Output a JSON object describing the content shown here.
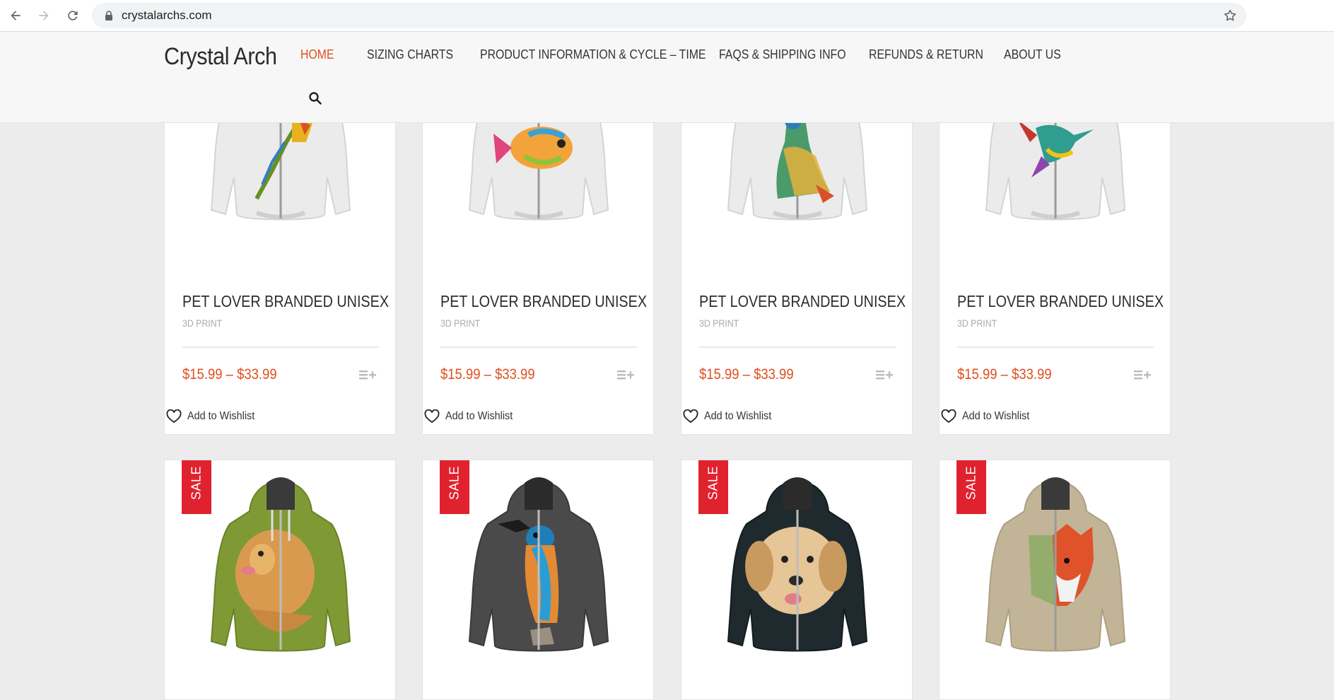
{
  "browser": {
    "url": "crystalarchs.com",
    "icons": [
      "back-arrow-icon",
      "forward-arrow-icon",
      "reload-icon",
      "lock-icon",
      "star-icon"
    ]
  },
  "site": {
    "title": "Crystal Arch",
    "accent_color": "#e04f1f",
    "menu": [
      {
        "label": "HOME",
        "active": true
      },
      {
        "label": "SIZING CHARTS",
        "active": false
      },
      {
        "label": "PRODUCT INFORMATION & CYCLE – TIME",
        "active": false
      },
      {
        "label": "FAQS & SHIPPING INFO",
        "active": false
      },
      {
        "label": "REFUNDS & RETURN",
        "active": false
      },
      {
        "label": "ABOUT US",
        "active": false
      }
    ],
    "search_icon": "search-icon"
  },
  "products_row1": [
    {
      "image": "white-hoodie-parrot",
      "title": "PET LOVER BRANDED UNISEX",
      "subtitle": "3D PRINT",
      "price": "$15.99 – $33.99",
      "wishlist": "Add to Wishlist"
    },
    {
      "image": "white-hoodie-fish",
      "title": "PET LOVER BRANDED UNISEX",
      "subtitle": "3D PRINT",
      "price": "$15.99 – $33.99",
      "wishlist": "Add to Wishlist"
    },
    {
      "image": "white-hoodie-peacock",
      "title": "PET LOVER BRANDED UNISEX",
      "subtitle": "3D PRINT",
      "price": "$15.99 – $33.99",
      "wishlist": "Add to Wishlist"
    },
    {
      "image": "white-hoodie-hummingbird",
      "title": "PET LOVER BRANDED UNISEX",
      "subtitle": "3D PRINT",
      "price": "$15.99 – $33.99",
      "wishlist": "Add to Wishlist"
    }
  ],
  "products_row2": [
    {
      "image": "green-hoodie-golden-retriever",
      "badge": "SALE"
    },
    {
      "image": "grey-hoodie-kingfisher",
      "badge": "SALE"
    },
    {
      "image": "black-hoodie-golden-retriever",
      "badge": "SALE"
    },
    {
      "image": "tan-hoodie-fox",
      "badge": "SALE"
    }
  ]
}
